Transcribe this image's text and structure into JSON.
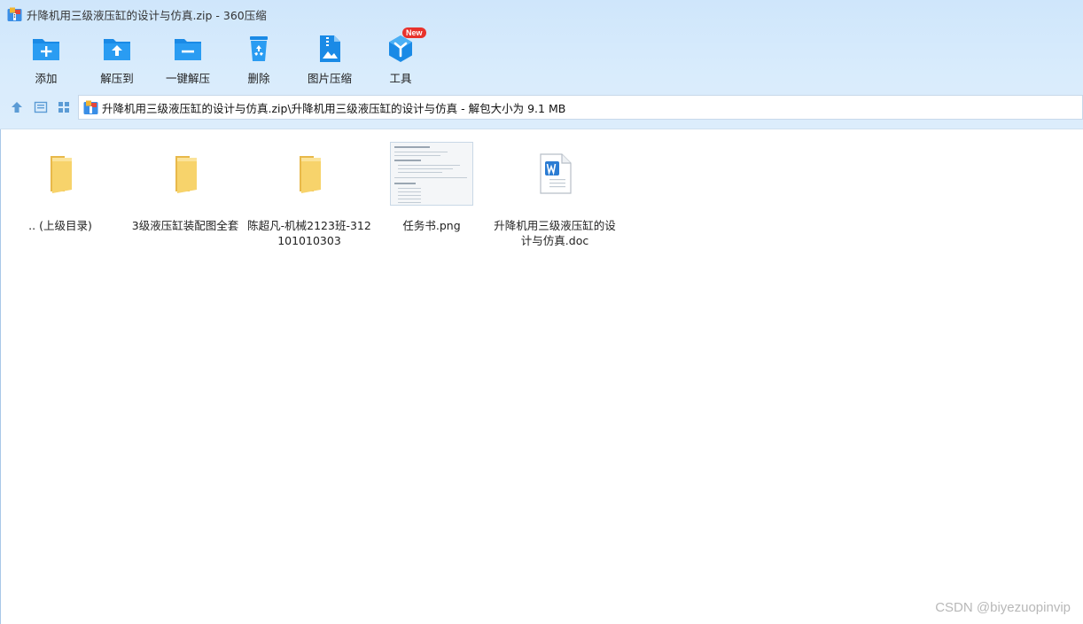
{
  "window": {
    "title": "升降机用三级液压缸的设计与仿真.zip - 360压缩"
  },
  "toolbar": {
    "items": [
      {
        "label": "添加",
        "icon": "add-folder-icon"
      },
      {
        "label": "解压到",
        "icon": "extract-to-icon"
      },
      {
        "label": "一键解压",
        "icon": "one-click-extract-icon"
      },
      {
        "label": "删除",
        "icon": "recycle-bin-icon"
      },
      {
        "label": "图片压缩",
        "icon": "image-compress-icon"
      },
      {
        "label": "工具",
        "icon": "tools-cube-icon",
        "badge": "New"
      }
    ]
  },
  "nav": {
    "path": "升降机用三级液压缸的设计与仿真.zip\\升降机用三级液压缸的设计与仿真 - 解包大小为 9.1 MB"
  },
  "files": [
    {
      "name": ".. (上级目录)",
      "type": "folder"
    },
    {
      "name": "3级液压缸装配图全套",
      "type": "folder"
    },
    {
      "name": "陈超凡-机械2123班-312101010303",
      "type": "folder"
    },
    {
      "name": "任务书.png",
      "type": "image"
    },
    {
      "name": "升降机用三级液压缸的设计与仿真.doc",
      "type": "word-doc"
    }
  ],
  "watermark": "CSDN @biyezuopinvip",
  "colors": {
    "accent": "#1a8ae6",
    "chrome_bg": "#d6eafc",
    "folder": "#f7d36b"
  }
}
